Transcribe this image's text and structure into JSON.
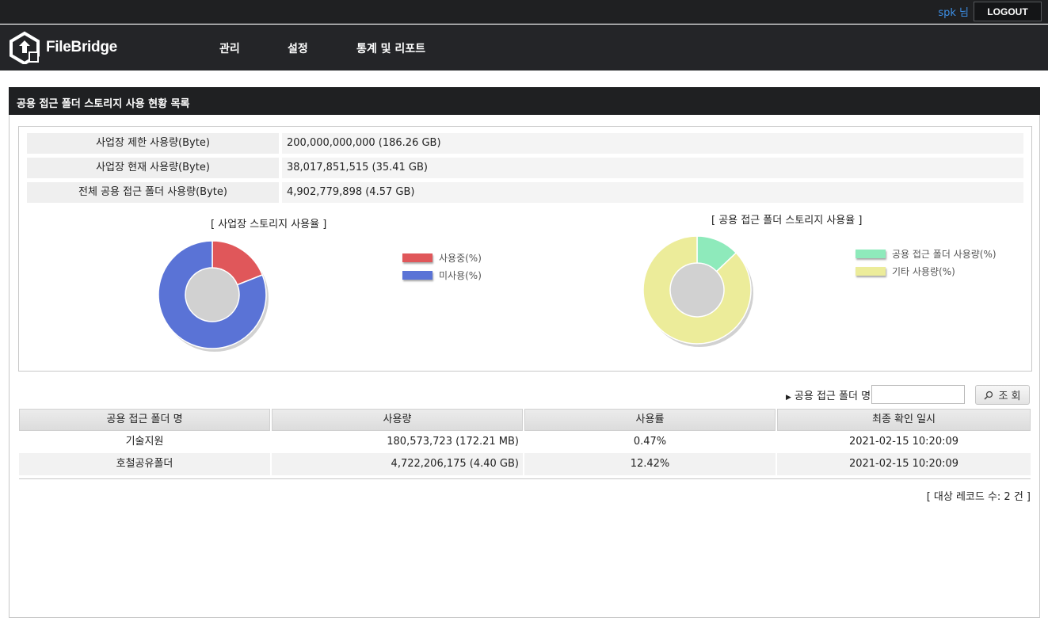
{
  "topbar": {
    "user": "spk 님",
    "logout": "LOGOUT"
  },
  "brand": {
    "name": "FileBridge"
  },
  "nav": {
    "items": [
      "관리",
      "설정",
      "통계 및 리포트"
    ]
  },
  "panel": {
    "title": "공용 접근 폴더 스토리지 사용 현황 목록"
  },
  "summary": [
    {
      "label": "사업장 제한 사용량(Byte)",
      "value": "200,000,000,000 (186.26 GB)"
    },
    {
      "label": "사업장 현재 사용량(Byte)",
      "value": "38,017,851,515 (35.41 GB)"
    },
    {
      "label": "전체 공용 접근 폴더 사용량(Byte)",
      "value": "4,902,779,898 (4.57 GB)"
    }
  ],
  "charts": [
    {
      "title": "[ 사업장 스토리지 사용율 ]",
      "legend": [
        "사용중(%)",
        "미사용(%)"
      ],
      "colors": [
        "#e0575a",
        "#5a73d6"
      ],
      "values": [
        19.01,
        80.99
      ]
    },
    {
      "title": "[ 공용 접근 폴더 스토리지 사용율 ]",
      "legend": [
        "공용 접근 폴더 사용량(%)",
        "기타 사용량(%)"
      ],
      "colors": [
        "#8eeabb",
        "#ecec9a"
      ],
      "values": [
        12.9,
        87.1
      ]
    }
  ],
  "search": {
    "label": "공용 접근 폴더 명",
    "value": "",
    "button": "조 회"
  },
  "table": {
    "headers": [
      "공용 접근 폴더 명",
      "사용량",
      "사용률",
      "최종 확인 일시"
    ],
    "rows": [
      [
        "기술지원",
        "180,573,723 (172.21 MB)",
        "0.47%",
        "2021-02-15 10:20:09"
      ],
      [
        "호철공유폴더",
        "4,722,206,175 (4.40 GB)",
        "12.42%",
        "2021-02-15 10:20:09"
      ]
    ]
  },
  "record_count": "[ 대상 레코드 수: 2 건 ]"
}
